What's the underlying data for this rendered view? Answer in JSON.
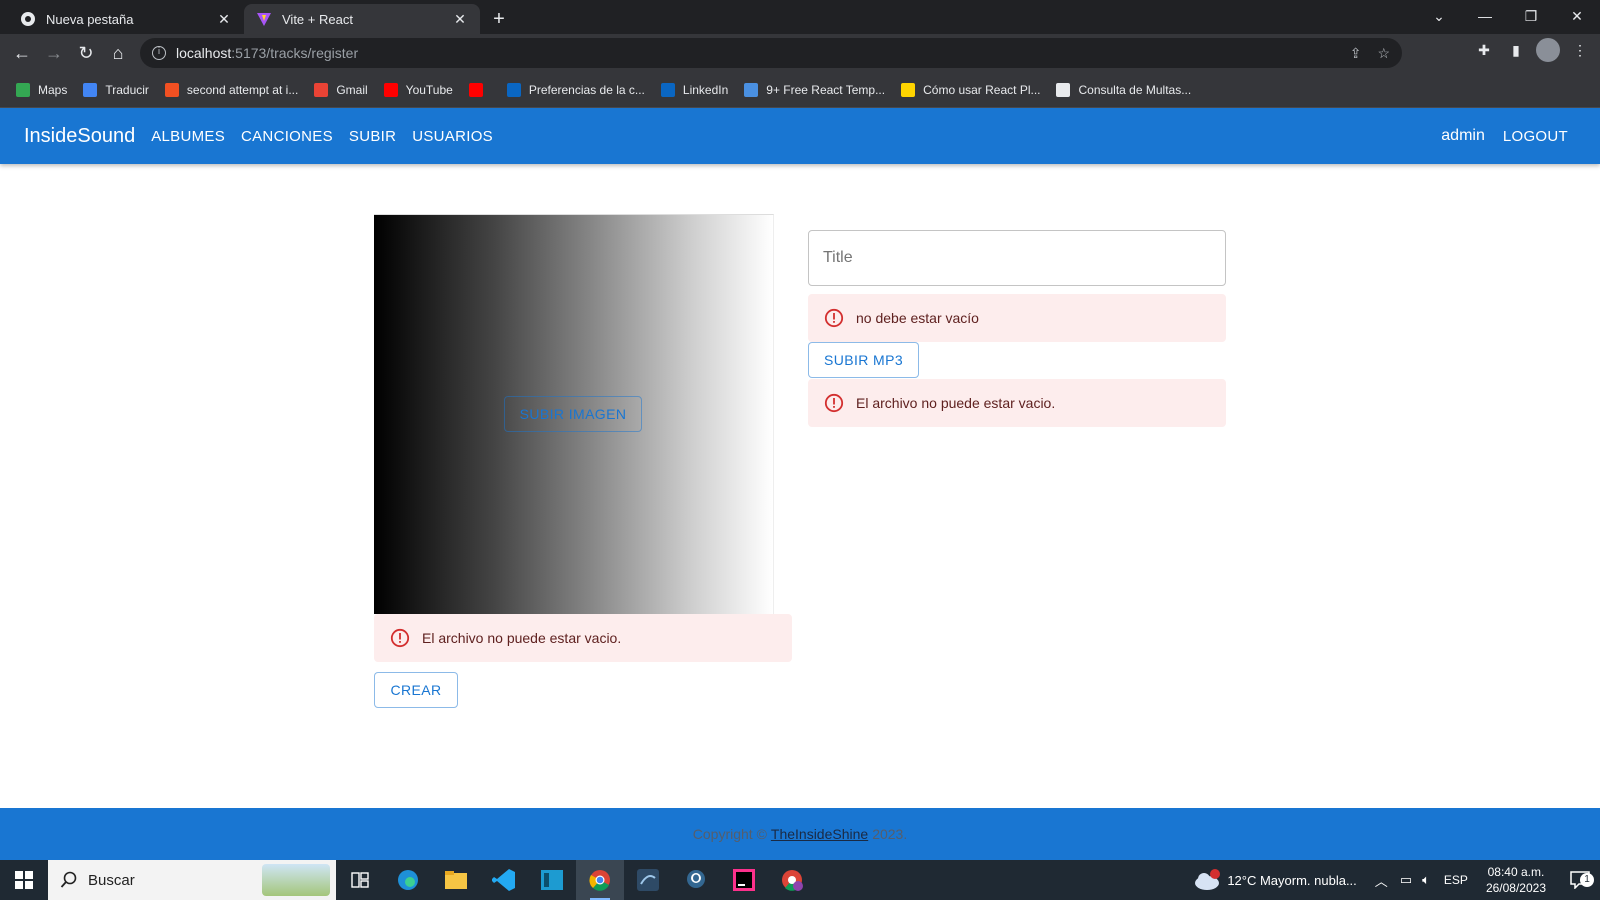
{
  "browser": {
    "tabs": [
      {
        "title": "Nueva pestaña",
        "active": false
      },
      {
        "title": "Vite + React",
        "active": true
      }
    ],
    "url_host": "localhost",
    "url_path": ":5173/tracks/register",
    "bookmarks": [
      {
        "label": "Maps",
        "icon": "maps-icon",
        "color": "#34a853"
      },
      {
        "label": "Traducir",
        "icon": "translate-icon",
        "color": "#4285f4"
      },
      {
        "label": "second attempt at i...",
        "icon": "microsoft-icon",
        "color": "#f25022"
      },
      {
        "label": "Gmail",
        "icon": "gmail-icon",
        "color": "#ea4335"
      },
      {
        "label": "YouTube",
        "icon": "youtube-icon",
        "color": "#ff0000"
      },
      {
        "label": "",
        "icon": "youtube-music-icon",
        "color": "#ff0000"
      },
      {
        "label": "Preferencias de la c...",
        "icon": "linkedin-icon",
        "color": "#0a66c2"
      },
      {
        "label": "LinkedIn",
        "icon": "linkedin-icon",
        "color": "#0a66c2"
      },
      {
        "label": "9+ Free React Temp...",
        "icon": "template-icon",
        "color": "#4a90e2"
      },
      {
        "label": "Cómo usar React Pl...",
        "icon": "cat-icon",
        "color": "#ffd400"
      },
      {
        "label": "Consulta de Multas...",
        "icon": "document-icon",
        "color": "#e8eaed"
      }
    ]
  },
  "appbar": {
    "brand": "InsideSound",
    "nav": [
      "ALBUMES",
      "CANCIONES",
      "SUBIR",
      "USUARIOS"
    ],
    "user": "admin",
    "logout": "LOGOUT"
  },
  "form": {
    "upload_image_label": "SUBIR IMAGEN",
    "image_error": "El archivo no puede estar vacio.",
    "create_label": "CREAR",
    "title_placeholder": "Title",
    "title_error": "no debe estar vacío",
    "upload_mp3_label": "SUBIR MP3",
    "mp3_error": "El archivo no puede estar vacio."
  },
  "footer": {
    "prefix": "Copyright ©",
    "link": "TheInsideShine",
    "suffix": "2023."
  },
  "taskbar": {
    "search_label": "Buscar",
    "weather": "12°C  Mayorm. nubla...",
    "lang": "ESP",
    "time": "08:40 a.m.",
    "date": "26/08/2023",
    "notif_count": "1",
    "weather_badge": "1"
  },
  "colors": {
    "primary": "#1976d2",
    "error_bg": "#fdeded",
    "error_icon": "#d32f2f"
  }
}
